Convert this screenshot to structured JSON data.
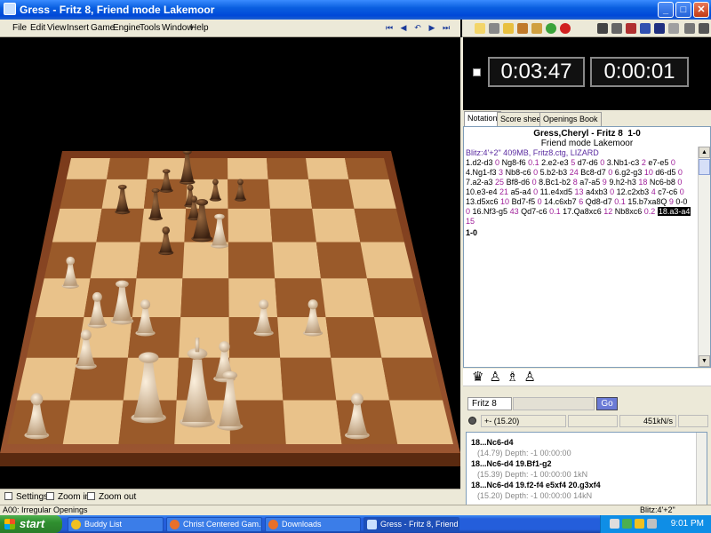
{
  "window": {
    "title": "Gress - Fritz 8, Friend mode Lakemoor",
    "buttons": {
      "minimize": "_",
      "maximize": "□",
      "close": "✕"
    }
  },
  "menu": {
    "items": [
      "File",
      "Edit",
      "View",
      "Insert",
      "Game",
      "Engine",
      "Tools",
      "Window",
      "Help"
    ],
    "nav": [
      "⏮",
      "◀",
      "↶",
      "▶",
      "⏭"
    ]
  },
  "clocks": {
    "white": "0:03:47",
    "black": "0:00:01"
  },
  "tabs": [
    "Notation",
    "Score sheet",
    "Openings Book"
  ],
  "notation": {
    "players": "Gress,Cheryl - Fritz 8",
    "result_head": "1-0",
    "event": "Friend mode Lakemoor",
    "meta": "Blitz:4'+2\"   409MB, Fritz8.ctg, LIZARD",
    "lines": [
      [
        "1.d2-d3",
        "0",
        "Ng8-f6",
        "0.1",
        "2.e2-e3",
        "5",
        "d7-d6",
        "0",
        "3.Nb1-c3",
        "2",
        "e7-e5",
        "0"
      ],
      [
        "4.Ng1-f3",
        "3",
        "Nb8-c6",
        "0",
        "5.b2-b3",
        "24",
        "Bc8-d7",
        "0",
        "6.g2-g3",
        "10",
        "d6-d5",
        "0"
      ],
      [
        "7.a2-a3",
        "25",
        "Bf8-d6",
        "0",
        "8.Bc1-b2",
        "8",
        "a7-a5",
        "9",
        "9.h2-h3",
        "18",
        "Nc6-b8",
        "0"
      ],
      [
        "10.e3-e4",
        "21",
        "a5-a4",
        "0",
        "11.e4xd5",
        "13",
        "a4xb3",
        "0",
        "12.c2xb3",
        "4",
        "c7-c6",
        "0"
      ],
      [
        "13.d5xc6",
        "10",
        "Bd7-f5",
        "0",
        "14.c6xb7",
        "6",
        "Qd8-d7",
        "0.1",
        "15.b7xa8Q",
        "9",
        "0-0",
        ""
      ],
      [
        "0",
        "",
        "16.Nf3-g5",
        "43",
        "Qd7-c6",
        "0.1",
        "17.Qa8xc6",
        "12",
        "Nb8xc6",
        "0.2"
      ]
    ],
    "current_move": "18.a3-a4",
    "trailing": "15",
    "result": "1-0"
  },
  "piece_strip": "♛♙♗♙",
  "engine": {
    "name": "Fritz 8",
    "go_label": "Go",
    "eval": "+- (15.20)",
    "speed": "451kN/s",
    "lines": [
      {
        "move": "18...Nc6-d4",
        "info": "(14.79)  Depth: -1   00:00:00"
      },
      {
        "move": "18...Nc6-d4 19.Bf1-g2",
        "info": "(15.39)  Depth: -1   00:00:00  1kN"
      },
      {
        "move": "18...Nc6-d4 19.f2-f4 e5xf4 20.g3xf4",
        "info": "(15.20)  Depth: -1   00:00:00  14kN"
      }
    ]
  },
  "board_controls": {
    "settings": "Settings",
    "zoom_in": "Zoom in",
    "zoom_out": "Zoom out"
  },
  "status": {
    "opening": "A00: Irregular Openings",
    "time_control": "Blitz:4'+2\""
  },
  "taskbar": {
    "start": "start",
    "buttons": [
      "Buddy List",
      "Christ Centered Gam...",
      "Downloads",
      "Gress - Fritz 8, Friend..."
    ],
    "time": "9:01 PM"
  }
}
